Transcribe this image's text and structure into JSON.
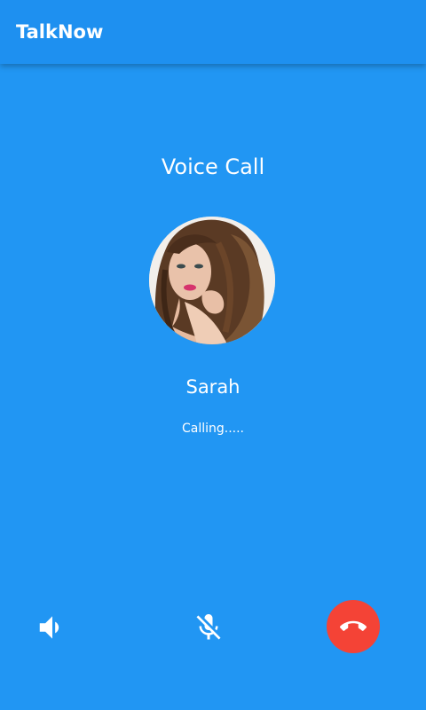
{
  "app": {
    "title": "TalkNow"
  },
  "call": {
    "type_label": "Voice Call",
    "caller_name": "Sarah",
    "status": "Calling....."
  },
  "controls": {
    "speaker_icon": "speaker-volume-icon",
    "mute_icon": "microphone-off-icon",
    "end_icon": "phone-hangup-icon"
  },
  "colors": {
    "background": "#2196F3",
    "end_call": "#F44336",
    "text": "#FFFFFF"
  }
}
